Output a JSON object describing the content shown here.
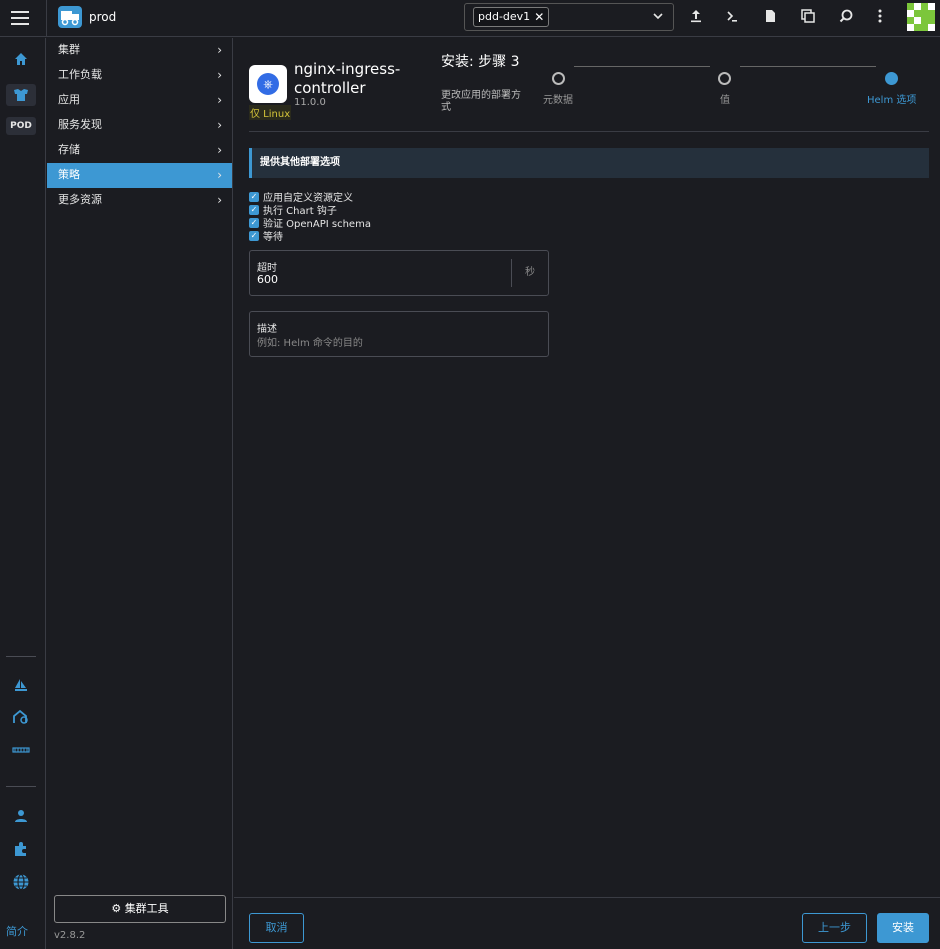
{
  "header": {
    "cluster_name": "prod",
    "namespace_chip": "pdd-dev1",
    "icons": [
      "upload-icon",
      "terminal-icon",
      "file-icon",
      "copy-icon",
      "search-icon",
      "more-vert-icon"
    ]
  },
  "rail": {
    "pod_label": "POD",
    "about_label": "简介"
  },
  "sidenav": {
    "items": [
      {
        "label": "集群"
      },
      {
        "label": "工作负载"
      },
      {
        "label": "应用"
      },
      {
        "label": "服务发现"
      },
      {
        "label": "存储"
      },
      {
        "label": "策略"
      },
      {
        "label": "更多资源"
      }
    ],
    "cluster_tools": "集群工具",
    "version": "v2.8.2"
  },
  "app": {
    "name": "nginx-ingress-controller",
    "version": "11.0.0",
    "linux_only": "仅 Linux"
  },
  "wizard": {
    "title": "安装: 步骤 3",
    "subtitle": "更改应用的部署方式",
    "steps": [
      {
        "label": "元数据",
        "active": false
      },
      {
        "label": "值",
        "active": false
      },
      {
        "label": "Helm 选项",
        "active": true
      }
    ]
  },
  "section": {
    "title": "提供其他部署选项"
  },
  "options": [
    {
      "label": "应用自定义资源定义",
      "checked": true
    },
    {
      "label": "执行 Chart 钩子",
      "checked": true
    },
    {
      "label": "验证 OpenAPI schema",
      "checked": true
    },
    {
      "label": "等待",
      "checked": true
    }
  ],
  "timeout": {
    "label": "超时",
    "value": "600",
    "suffix": "秒"
  },
  "description": {
    "label": "描述",
    "placeholder": "例如: Helm 命令的目的"
  },
  "footer": {
    "cancel": "取消",
    "previous": "上一步",
    "install": "安装"
  },
  "colors": {
    "accent": "#3d98d3",
    "background": "#1b1c21",
    "linux_badge": "#d4c43a"
  }
}
